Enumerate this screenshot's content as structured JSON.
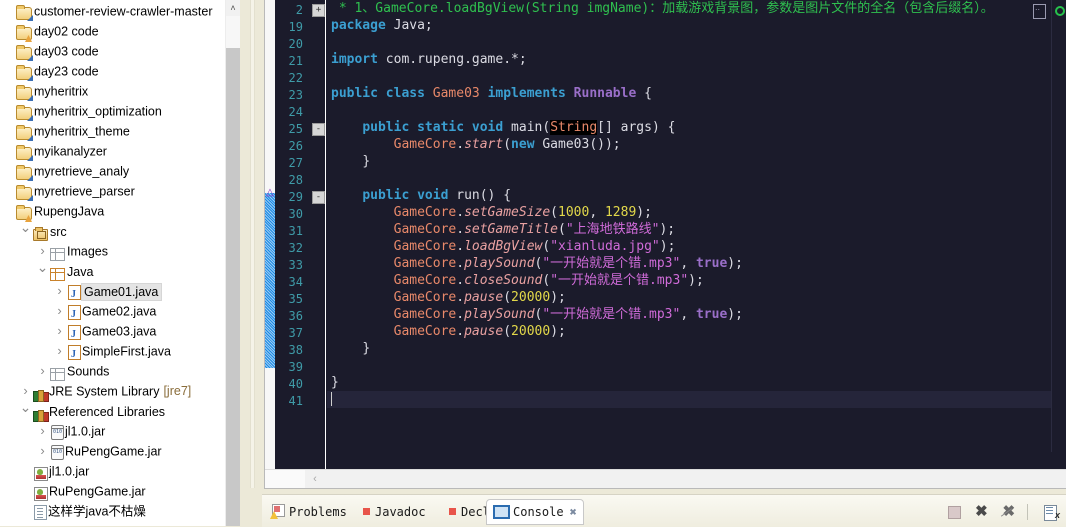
{
  "explorer": {
    "items": [
      {
        "label": "customer-review-crawler-master",
        "icon": "project-warning-icon",
        "indent": 0,
        "arrow": "none",
        "type": "proj"
      },
      {
        "label": "day02 code",
        "icon": "project-icon",
        "indent": 0,
        "arrow": "none",
        "type": "proj2"
      },
      {
        "label": "day03 code",
        "icon": "project-warning-icon",
        "indent": 0,
        "arrow": "none",
        "type": "proj"
      },
      {
        "label": "day23 code",
        "icon": "project-warning-icon",
        "indent": 0,
        "arrow": "none",
        "type": "proj"
      },
      {
        "label": "myheritrix",
        "icon": "project-warning-icon",
        "indent": 0,
        "arrow": "none",
        "type": "proj"
      },
      {
        "label": "myheritrix_optimization",
        "icon": "project-warning-icon",
        "indent": 0,
        "arrow": "none",
        "type": "proj"
      },
      {
        "label": "myheritrix_theme",
        "icon": "project-warning-icon",
        "indent": 0,
        "arrow": "none",
        "type": "proj"
      },
      {
        "label": "myikanalyzer",
        "icon": "project-warning-icon",
        "indent": 0,
        "arrow": "none",
        "type": "proj"
      },
      {
        "label": "myretrieve_analy",
        "icon": "project-warning-icon",
        "indent": 0,
        "arrow": "none",
        "type": "proj"
      },
      {
        "label": "myretrieve_parser",
        "icon": "project-warning-icon",
        "indent": 0,
        "arrow": "none",
        "type": "proj"
      },
      {
        "label": "RupengJava",
        "icon": "project-icon",
        "indent": 0,
        "arrow": "none",
        "type": "proj2"
      },
      {
        "label": "src",
        "icon": "source-folder-icon",
        "indent": 1,
        "arrow": "down",
        "type": "src"
      },
      {
        "label": "Images",
        "icon": "package-icon",
        "indent": 2,
        "arrow": "right",
        "type": "pkg"
      },
      {
        "label": "Java",
        "icon": "package-icon",
        "indent": 2,
        "arrow": "down",
        "type": "pkg2"
      },
      {
        "label": "Game01.java",
        "icon": "java-file-icon",
        "indent": 3,
        "arrow": "right",
        "type": "java",
        "selected": true
      },
      {
        "label": "Game02.java",
        "icon": "java-file-icon",
        "indent": 3,
        "arrow": "right",
        "type": "java"
      },
      {
        "label": "Game03.java",
        "icon": "java-file-icon",
        "indent": 3,
        "arrow": "right",
        "type": "java"
      },
      {
        "label": "SimpleFirst.java",
        "icon": "java-file-icon",
        "indent": 3,
        "arrow": "right",
        "type": "java"
      },
      {
        "label": "Sounds",
        "icon": "package-icon",
        "indent": 2,
        "arrow": "right",
        "type": "pkg"
      },
      {
        "label": "JRE System Library",
        "suffix": "[jre7]",
        "icon": "library-icon",
        "indent": 1,
        "arrow": "right",
        "type": "lib"
      },
      {
        "label": "Referenced Libraries",
        "icon": "library-icon",
        "indent": 1,
        "arrow": "down",
        "type": "lib"
      },
      {
        "label": "jl1.0.jar",
        "icon": "jar-icon",
        "indent": 2,
        "arrow": "right",
        "type": "jar"
      },
      {
        "label": "RuPengGame.jar",
        "icon": "jar-icon",
        "indent": 2,
        "arrow": "right",
        "type": "jar"
      },
      {
        "label": "jl1.0.jar",
        "icon": "jar-file-icon",
        "indent": 1,
        "arrow": "none",
        "type": "jarf"
      },
      {
        "label": "RuPengGame.jar",
        "icon": "jar-file-icon",
        "indent": 1,
        "arrow": "none",
        "type": "jarf"
      },
      {
        "label": "这样学java不枯燥",
        "icon": "text-file-icon",
        "indent": 1,
        "arrow": "none",
        "type": "doc"
      }
    ],
    "scrollbar": {
      "up_arrow": "˄"
    }
  },
  "editor": {
    "lines": [
      {
        "n": "2",
        "fold": "+",
        "html": "<span class='cmt'> * 1、GameCore.loadBgView(String imgName)：加载游戏背景图，参数是图片文件的全名（包含后缀名）。</span>"
      },
      {
        "n": "19",
        "html": "<span class='kw'>package</span> <span class='plain'>Java;</span>"
      },
      {
        "n": "20",
        "html": ""
      },
      {
        "n": "21",
        "html": "<span class='kw'>import</span> <span class='plain'>com.rupeng.game.*;</span>"
      },
      {
        "n": "22",
        "html": ""
      },
      {
        "n": "23",
        "html": "<span class='kw'>public</span> <span class='kw'>class</span> <span class='cls'>Game03</span> <span class='kw'>implements</span> <span class='kw2'>Runnable</span> <span class='plain'>{</span>"
      },
      {
        "n": "24",
        "html": ""
      },
      {
        "n": "25",
        "fold": "-",
        "html": "    <span class='kw'>public</span> <span class='kw'>static</span> <span class='kw'>void</span> <span class='plain'>main(</span><span class='typehl'>String</span><span class='plain'>[] args) {</span>"
      },
      {
        "n": "26",
        "html": "        <span class='recv'>GameCore</span><span class='plain'>.</span><span class='mth'>start</span><span class='plain'>(</span><span class='kw'>new</span> <span class='plain'>Game03());</span>"
      },
      {
        "n": "27",
        "html": "    <span class='plain'>}</span>"
      },
      {
        "n": "28",
        "html": ""
      },
      {
        "n": "29",
        "fold": "-",
        "html": "    <span class='kw'>public</span> <span class='kw'>void</span> <span class='plain'>run() {</span>"
      },
      {
        "n": "30",
        "html": "        <span class='recv'>GameCore</span><span class='plain'>.</span><span class='mth'>setGameSize</span><span class='plain'>(</span><span class='num'>1000</span><span class='plain'>, </span><span class='num'>1289</span><span class='plain'>);</span>"
      },
      {
        "n": "31",
        "html": "        <span class='recv'>GameCore</span><span class='plain'>.</span><span class='mth'>setGameTitle</span><span class='plain'>(</span><span class='str'>\"上海地铁路线\"</span><span class='plain'>);</span>"
      },
      {
        "n": "32",
        "html": "        <span class='recv'>GameCore</span><span class='plain'>.</span><span class='mth'>loadBgView</span><span class='plain'>(</span><span class='str'>\"xianluda.jpg\"</span><span class='plain'>);</span>"
      },
      {
        "n": "33",
        "html": "        <span class='recv'>GameCore</span><span class='plain'>.</span><span class='mth'>playSound</span><span class='plain'>(</span><span class='str'>\"一开始就是个错.mp3\"</span><span class='plain'>, </span><span class='bool'>true</span><span class='plain'>);</span>"
      },
      {
        "n": "34",
        "html": "        <span class='recv'>GameCore</span><span class='plain'>.</span><span class='mth'>closeSound</span><span class='plain'>(</span><span class='str'>\"一开始就是个错.mp3\"</span><span class='plain'>);</span>"
      },
      {
        "n": "35",
        "html": "        <span class='recv'>GameCore</span><span class='plain'>.</span><span class='mth'>pause</span><span class='plain'>(</span><span class='num'>20000</span><span class='plain'>);</span>"
      },
      {
        "n": "36",
        "html": "        <span class='recv'>GameCore</span><span class='plain'>.</span><span class='mth'>playSound</span><span class='plain'>(</span><span class='str'>\"一开始就是个错.mp3\"</span><span class='plain'>, </span><span class='bool'>true</span><span class='plain'>);</span>"
      },
      {
        "n": "37",
        "html": "        <span class='recv'>GameCore</span><span class='plain'>.</span><span class='mth'>pause</span><span class='plain'>(</span><span class='num'>20000</span><span class='plain'>);</span>"
      },
      {
        "n": "38",
        "html": "    <span class='plain'>}</span>"
      },
      {
        "n": "39",
        "html": ""
      },
      {
        "n": "40",
        "html": "<span class='plain'>}</span>"
      },
      {
        "n": "41",
        "html": "",
        "current": true
      }
    ],
    "scroll_left_arrow": "‹",
    "overview_box": ".."
  },
  "bottom": {
    "tabs": [
      {
        "label": "Problems",
        "icon": "problems-icon",
        "active": false
      },
      {
        "label": "Javadoc",
        "icon": "javadoc-icon",
        "active": false
      },
      {
        "label": "Declaration",
        "icon": "declaration-icon",
        "active": false
      },
      {
        "label": "Console",
        "icon": "console-icon",
        "active": true,
        "close": "✖"
      }
    ],
    "tools": [
      {
        "name": "terminate-button",
        "glyph": ""
      },
      {
        "name": "remove-launch-button",
        "glyph": "✖"
      },
      {
        "name": "remove-all-terminated-button",
        "glyph": "✖"
      },
      {
        "name": "clear-console-button",
        "glyph": "✖"
      }
    ]
  }
}
